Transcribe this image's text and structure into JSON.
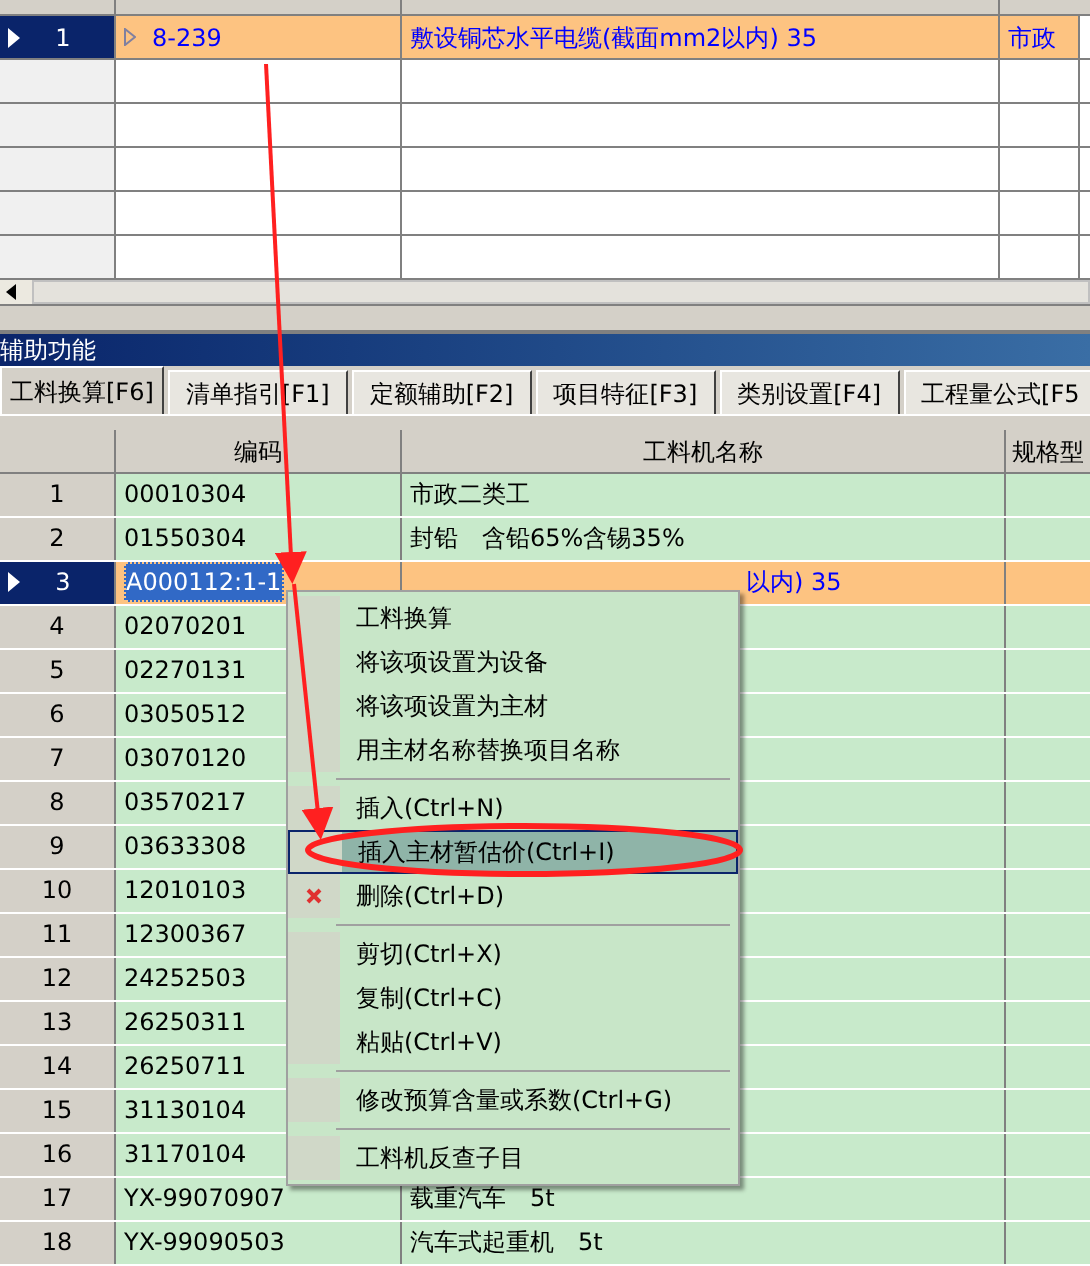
{
  "top_grid": {
    "rows": [
      {
        "num": "1",
        "selected": true,
        "code": "8-239",
        "name": "敷设铜芯水平电缆(截面mm2以内) 35",
        "col4": "市政"
      },
      {
        "num": "",
        "selected": false,
        "code": "",
        "name": "",
        "col4": ""
      },
      {
        "num": "",
        "selected": false,
        "code": "",
        "name": "",
        "col4": ""
      },
      {
        "num": "",
        "selected": false,
        "code": "",
        "name": "",
        "col4": ""
      },
      {
        "num": "",
        "selected": false,
        "code": "",
        "name": "",
        "col4": ""
      },
      {
        "num": "",
        "selected": false,
        "code": "",
        "name": "",
        "col4": ""
      }
    ]
  },
  "panel": {
    "title": "辅助功能",
    "tabs": [
      {
        "label": "工料换算[F6]",
        "selected": true
      },
      {
        "label": "清单指引[F1]",
        "selected": false
      },
      {
        "label": "定额辅助[F2]",
        "selected": false
      },
      {
        "label": "项目特征[F3]",
        "selected": false
      },
      {
        "label": "类别设置[F4]",
        "selected": false
      },
      {
        "label": "工程量公式[F5",
        "selected": false
      }
    ],
    "columns": [
      "编码",
      "工料机名称",
      "规格型"
    ],
    "rows": [
      {
        "num": "1",
        "selected": false,
        "code": "00010304",
        "name": "市政二类工"
      },
      {
        "num": "2",
        "selected": false,
        "code": "01550304",
        "name": "封铅　含铅65%含锡35%"
      },
      {
        "num": "3",
        "selected": true,
        "code": "A000112:1-1",
        "name": "以内) 35"
      },
      {
        "num": "4",
        "selected": false,
        "code": "02070201",
        "name": ""
      },
      {
        "num": "5",
        "selected": false,
        "code": "02270131",
        "name": ""
      },
      {
        "num": "6",
        "selected": false,
        "code": "03050512",
        "name": ""
      },
      {
        "num": "7",
        "selected": false,
        "code": "03070120",
        "name": ""
      },
      {
        "num": "8",
        "selected": false,
        "code": "03570217",
        "name": ""
      },
      {
        "num": "9",
        "selected": false,
        "code": "03633308",
        "name": ""
      },
      {
        "num": "10",
        "selected": false,
        "code": "12010103",
        "name": ""
      },
      {
        "num": "11",
        "selected": false,
        "code": "12300367",
        "name": ""
      },
      {
        "num": "12",
        "selected": false,
        "code": "24252503",
        "name": ""
      },
      {
        "num": "13",
        "selected": false,
        "code": "26250311",
        "name": ""
      },
      {
        "num": "14",
        "selected": false,
        "code": "26250711",
        "name": ""
      },
      {
        "num": "15",
        "selected": false,
        "code": "31130104",
        "name": ""
      },
      {
        "num": "16",
        "selected": false,
        "code": "31170104",
        "name": ""
      },
      {
        "num": "17",
        "selected": false,
        "code": "YX-99070907",
        "name": "载重汽车　5t"
      },
      {
        "num": "18",
        "selected": false,
        "code": "YX-99090503",
        "name": "汽车式起重机　5t"
      }
    ]
  },
  "context_menu": {
    "items": [
      {
        "kind": "item",
        "label": "工料换算",
        "selected": false
      },
      {
        "kind": "item",
        "label": "将该项设置为设备",
        "selected": false
      },
      {
        "kind": "item",
        "label": "将该项设置为主材",
        "selected": false
      },
      {
        "kind": "item",
        "label": "用主材名称替换项目名称",
        "selected": false
      },
      {
        "kind": "separator"
      },
      {
        "kind": "item",
        "label": "插入(Ctrl+N)",
        "selected": false
      },
      {
        "kind": "item",
        "label": "插入主材暂估价(Ctrl+I)",
        "selected": true
      },
      {
        "kind": "delete",
        "label": "删除(Ctrl+D)",
        "selected": false
      },
      {
        "kind": "separator"
      },
      {
        "kind": "item",
        "label": "剪切(Ctrl+X)",
        "selected": false
      },
      {
        "kind": "item",
        "label": "复制(Ctrl+C)",
        "selected": false
      },
      {
        "kind": "item",
        "label": "粘贴(Ctrl+V)",
        "selected": false
      },
      {
        "kind": "separator"
      },
      {
        "kind": "item",
        "label": "修改预算含量或系数(Ctrl+G)",
        "selected": false
      },
      {
        "kind": "separator"
      },
      {
        "kind": "item",
        "label": "工料机反查子目",
        "selected": false
      }
    ]
  }
}
